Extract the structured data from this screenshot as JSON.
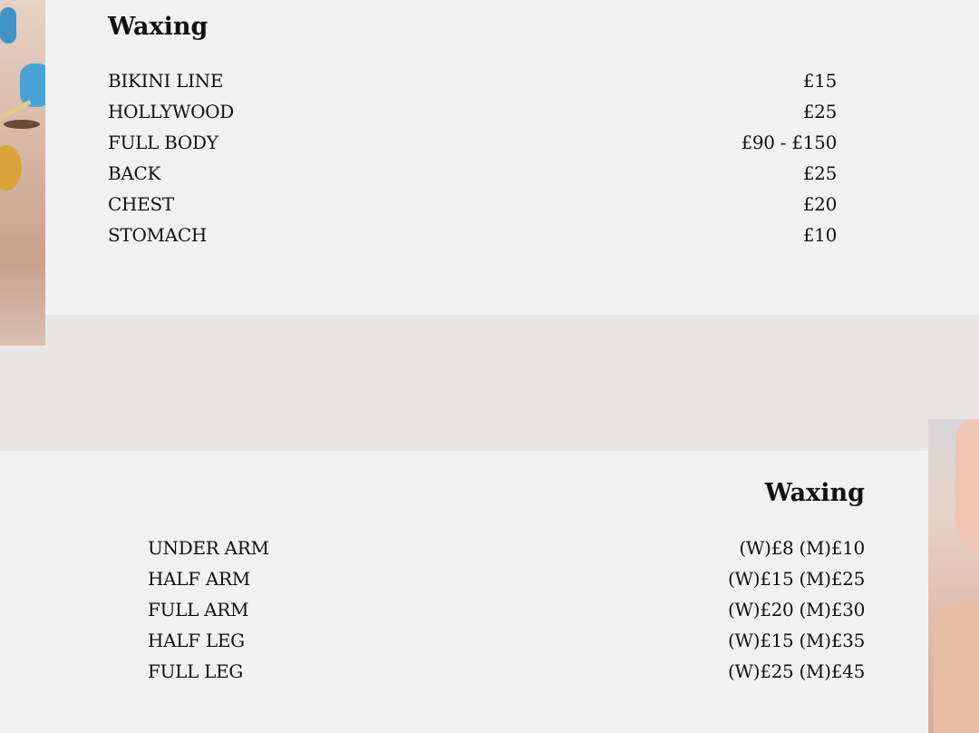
{
  "sections": [
    {
      "title": "Waxing",
      "items": [
        {
          "name": "BIKINI LINE",
          "price": "£15"
        },
        {
          "name": "HOLLYWOOD",
          "price": "£25"
        },
        {
          "name": "FULL BODY",
          "price": "£90 - £150"
        },
        {
          "name": "BACK",
          "price": "£25"
        },
        {
          "name": "CHEST",
          "price": "£20"
        },
        {
          "name": "STOMACH",
          "price": "£10"
        }
      ]
    },
    {
      "title": "Waxing",
      "items": [
        {
          "name": "UNDER ARM",
          "price": "(W)£8 (M)£10"
        },
        {
          "name": "HALF ARM",
          "price": "(W)£15 (M)£25"
        },
        {
          "name": "FULL ARM",
          "price": "(W)£20 (M)£30"
        },
        {
          "name": "HALF LEG",
          "price": "(W)£15 (M)£35"
        },
        {
          "name": "FULL LEG",
          "price": "(W)£25 (M)£45"
        }
      ]
    }
  ]
}
